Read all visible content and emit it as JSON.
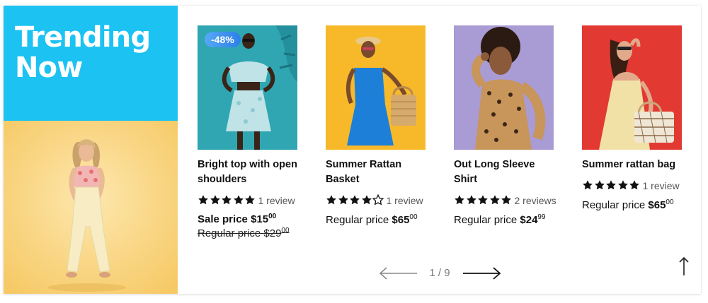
{
  "promo": {
    "title": "Trending Now",
    "colors": {
      "title_bg": "#1cc2f2",
      "photo_bg": "#fbd98f"
    }
  },
  "products": [
    {
      "badge": "-48%",
      "name": "Bright top with open shoulders",
      "stars": 5,
      "reviews": "1 review",
      "sale_label": "Sale price",
      "sale_main": "$15",
      "sale_cents": "00",
      "regular_label": "Regular price",
      "regular_main": "$29",
      "regular_cents": "00",
      "image_icon": "woman-floral-dress-image"
    },
    {
      "name": "Summer Rattan Basket",
      "stars": 4,
      "reviews": "1 review",
      "regular_label": "Regular price",
      "regular_main": "$65",
      "regular_cents": "00",
      "image_icon": "woman-blue-dress-image"
    },
    {
      "name": "Out Long Sleeve Shirt",
      "stars": 5,
      "reviews": "2 reviews",
      "regular_label": "Regular price",
      "regular_main": "$24",
      "regular_cents": "99",
      "image_icon": "woman-leopard-shirt-image"
    },
    {
      "name": "Summer rattan bag",
      "stars": 5,
      "reviews": "1 review",
      "regular_label": "Regular price",
      "regular_main": "$65",
      "regular_cents": "00",
      "image_icon": "woman-rattan-bag-image"
    }
  ],
  "pager": {
    "current": "1 / 9"
  },
  "icons": {
    "prev": "arrow-left-icon",
    "next": "arrow-right-icon",
    "back_to_top": "arrow-up-icon",
    "star": "star-icon"
  }
}
